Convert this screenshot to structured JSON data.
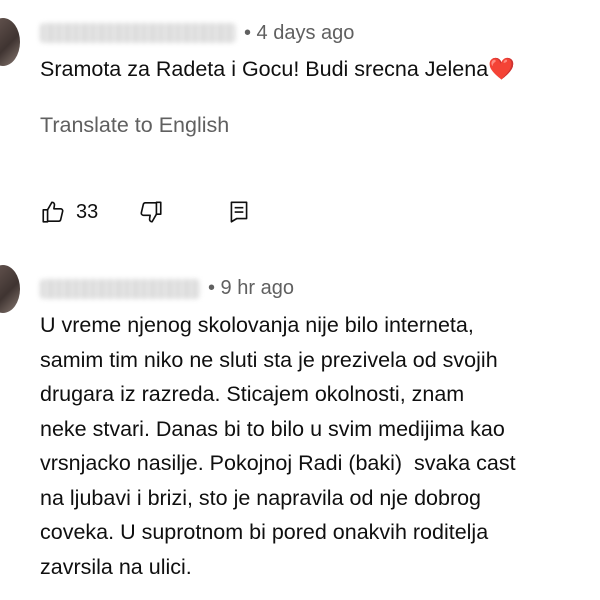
{
  "comments": [
    {
      "time": "• 4 days ago",
      "text": "Sramota za Radeta i Gocu! Budi srecna Jelena",
      "emoji": "❤️",
      "translate_label": "Translate to English",
      "likes": "33",
      "icons": [
        "thumbs-up-icon",
        "thumbs-down-icon",
        "reply-icon"
      ]
    },
    {
      "time": "• 9 hr ago",
      "lines": [
        "U vreme njenog skolovanja nije bilo interneta,",
        "samim tim niko ne sluti sta je prezivela od svojih",
        "drugara iz razreda. Sticajem okolnosti, znam",
        "neke stvari. Danas bi to bilo u svim medijima kao",
        "vrsnjacko nasilje. Pokojnoj Radi (baki)  svaka cast",
        "na ljubavi i brizi, sto je napravila od nje dobrog",
        "coveka. U suprotnom bi pored onakvih roditelja",
        "zavrsila na ulici."
      ]
    }
  ]
}
